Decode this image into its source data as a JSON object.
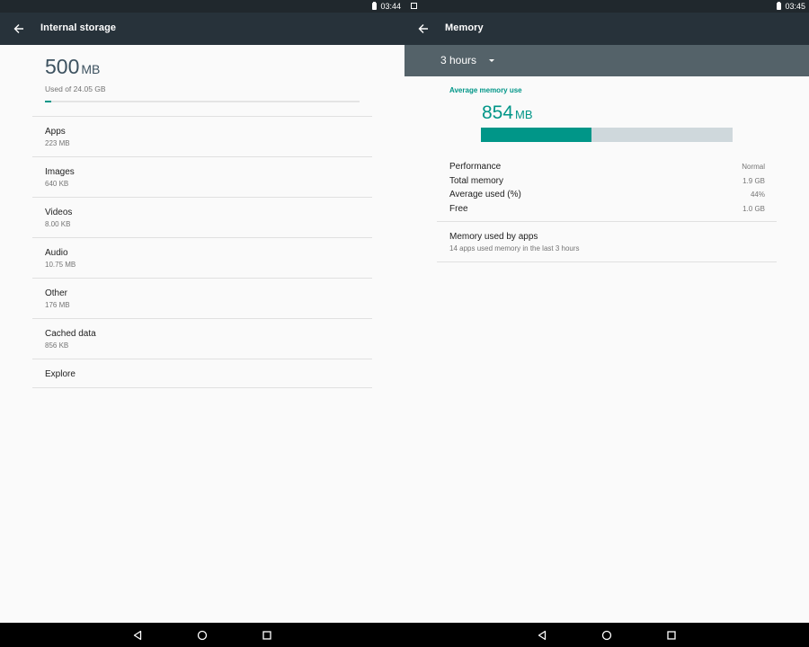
{
  "left": {
    "status": {
      "time": "03:44"
    },
    "toolbar": {
      "title": "Internal storage"
    },
    "summary": {
      "value": "500",
      "unit": "MB",
      "subtitle": "Used of 24.05 GB",
      "used_fraction": 0.02
    },
    "items": [
      {
        "title": "Apps",
        "subtitle": "223 MB"
      },
      {
        "title": "Images",
        "subtitle": "640 KB"
      },
      {
        "title": "Videos",
        "subtitle": "8.00 KB"
      },
      {
        "title": "Audio",
        "subtitle": "10.75 MB"
      },
      {
        "title": "Other",
        "subtitle": "176 MB"
      },
      {
        "title": "Cached data",
        "subtitle": "856 KB"
      },
      {
        "title": "Explore",
        "subtitle": ""
      }
    ]
  },
  "right": {
    "status": {
      "time": "03:45"
    },
    "toolbar": {
      "title": "Memory"
    },
    "period": {
      "selected": "3 hours"
    },
    "average": {
      "label": "Average memory use",
      "value": "854",
      "unit": "MB",
      "used_fraction": 0.44
    },
    "stats": [
      {
        "label": "Performance",
        "value": "Normal"
      },
      {
        "label": "Total memory",
        "value": "1.9 GB"
      },
      {
        "label": "Average used (%)",
        "value": "44%"
      },
      {
        "label": "Free",
        "value": "1.0 GB"
      }
    ],
    "apps": {
      "title": "Memory used by apps",
      "subtitle": "14 apps used memory in the last 3 hours"
    }
  },
  "colors": {
    "accent": "#009688",
    "toolbar": "#27323a",
    "statusbar": "#20282d",
    "period_bar": "#546269",
    "bar_track": "#cfd8dc"
  },
  "icons": [
    "back-arrow-icon",
    "battery-icon",
    "screenshot-notification-icon",
    "dropdown-caret-icon",
    "nav-back-icon",
    "nav-home-icon",
    "nav-recents-icon"
  ]
}
